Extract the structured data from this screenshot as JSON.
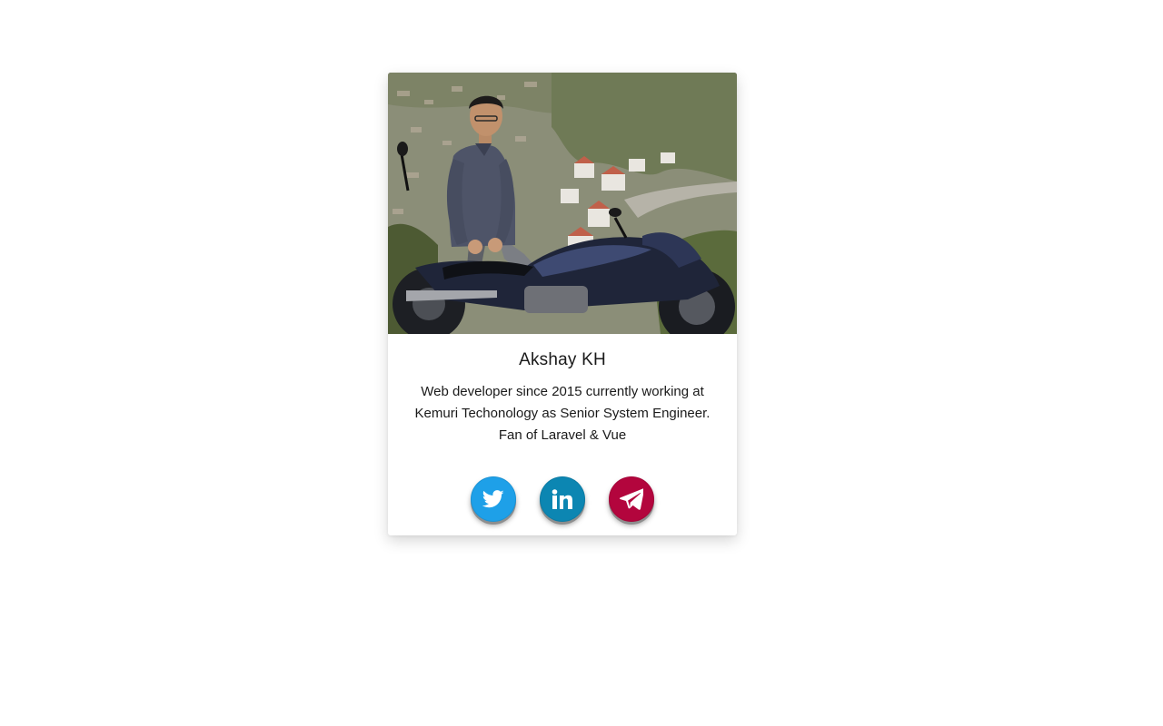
{
  "profile": {
    "photo_alt": "Man sitting on a motorcycle in front of a hillside town",
    "name": "Akshay KH",
    "bio": "Web developer since 2015 currently working at Kemuri Techonology as Senior System Engineer. Fan of Laravel & Vue"
  },
  "socials": [
    {
      "icon": "twitter-icon",
      "color": "#1da1f2"
    },
    {
      "icon": "linkedin-icon",
      "color": "#0e87b5"
    },
    {
      "icon": "telegram-icon",
      "color": "#b3063c"
    }
  ]
}
